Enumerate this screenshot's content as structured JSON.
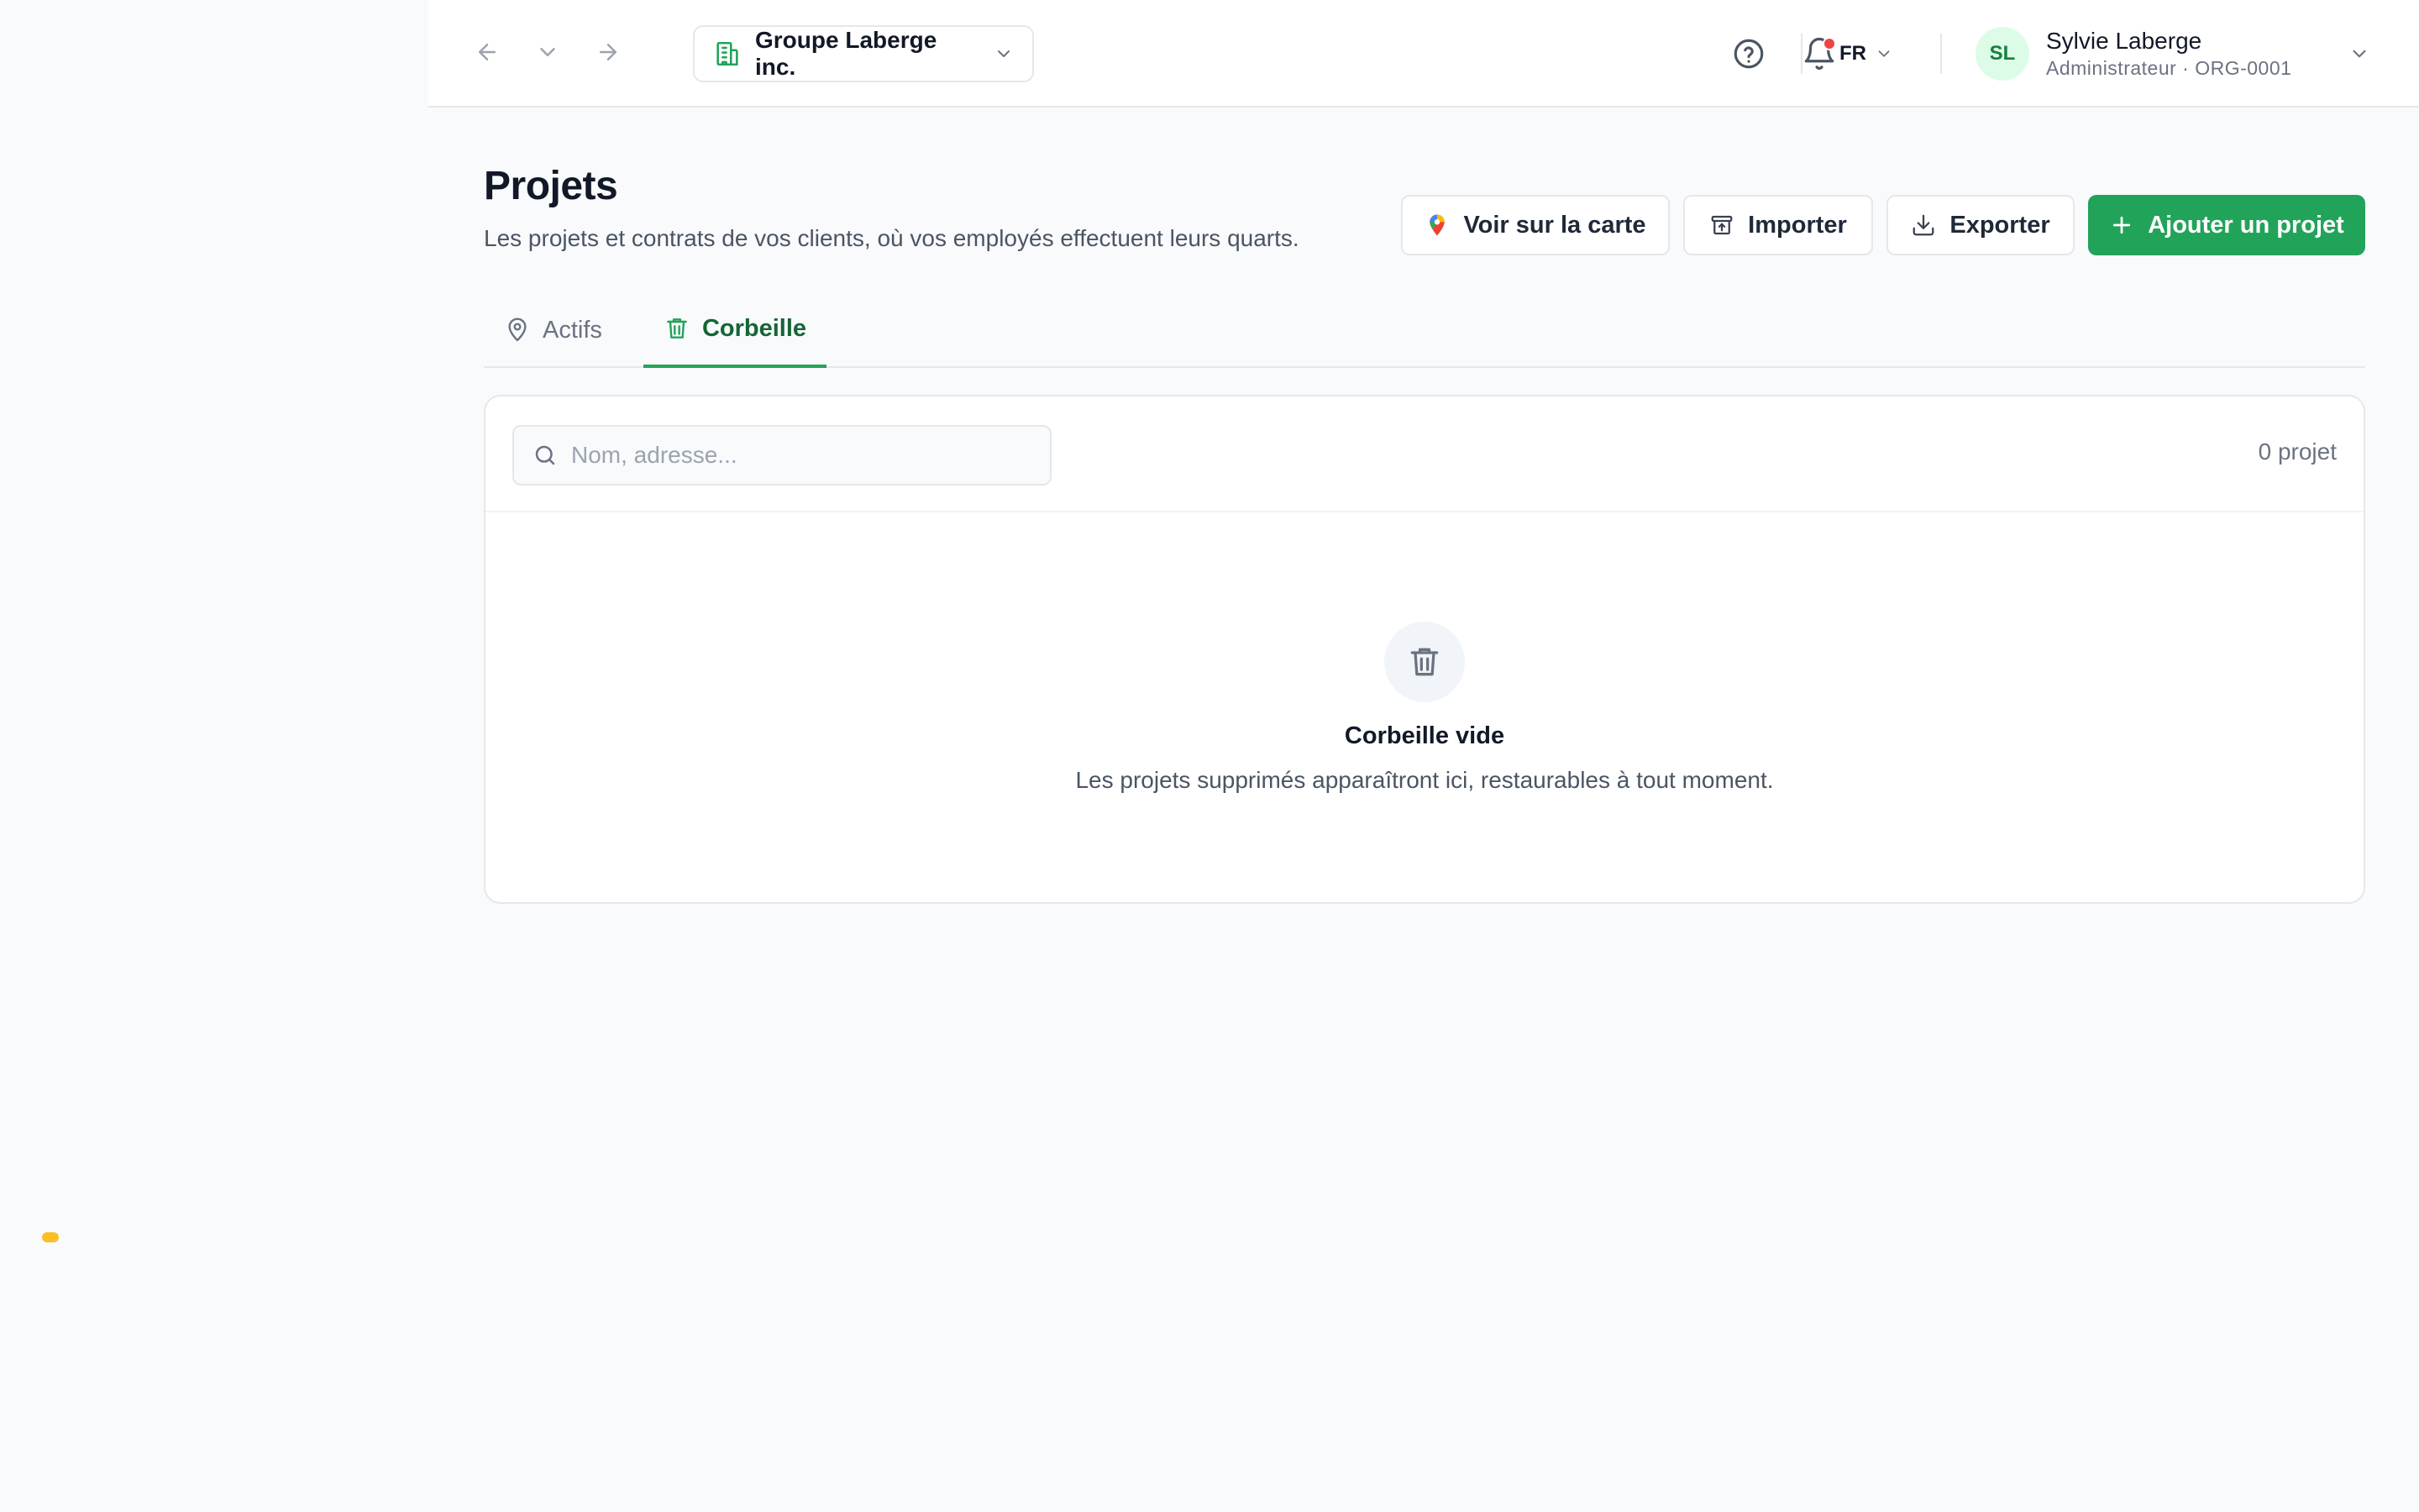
{
  "topbar": {
    "org_name": "Groupe Laberge inc.",
    "language": "FR",
    "user": {
      "initials": "SL",
      "name": "Sylvie Laberge",
      "role": "Administrateur · ORG-0001"
    },
    "notification_unread": true
  },
  "page": {
    "title": "Projets",
    "subtitle": "Les projets et contrats de vos clients, où vos employés effectuent leurs quarts."
  },
  "actions": {
    "map_label": "Voir sur la carte",
    "import_label": "Importer",
    "export_label": "Exporter",
    "add_label": "Ajouter un projet"
  },
  "tabs": [
    {
      "label": "Actifs",
      "active": false,
      "icon": "map-pin-icon"
    },
    {
      "label": "Corbeille",
      "active": true,
      "icon": "trash-icon"
    }
  ],
  "list": {
    "search_placeholder": "Nom, adresse...",
    "search_value": "",
    "count_label": "0 projet"
  },
  "empty_state": {
    "title": "Corbeille vide",
    "description": "Les projets supprimés apparaîtront ici, restaurables à tout moment."
  },
  "colors": {
    "primary": "#22a35a",
    "primary_dark": "#166534",
    "notification": "#ef4444",
    "background": "#f8fafc"
  }
}
